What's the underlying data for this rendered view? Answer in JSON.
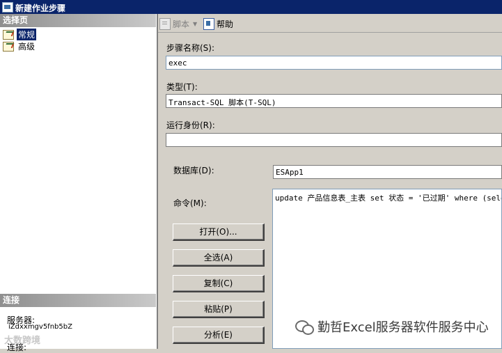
{
  "window": {
    "title": "新建作业步骤"
  },
  "left_panel": {
    "select_page_header": "选择页",
    "pages": [
      {
        "label": "常规",
        "selected": true
      },
      {
        "label": "高级",
        "selected": false
      }
    ],
    "connection_header": "连接",
    "server_label": "服务器:",
    "server_value": "iZdxxmgv5fnb5bZ",
    "connection_label": "连接:",
    "watermark": "大数跨境"
  },
  "toolbar": {
    "script_label": "脚本",
    "help_label": "帮助"
  },
  "form": {
    "step_name_label": "步骤名称(S):",
    "step_name_value": "exec",
    "type_label": "类型(T):",
    "type_value": "Transact-SQL 脚本(T-SQL)",
    "run_as_label": "运行身份(R):",
    "run_as_value": "",
    "database_label": "数据库(D):",
    "database_value": "ESApp1",
    "command_label": "命令(M):",
    "command_value": "update 产品信息表_主表 set 状态 = '已过期' where  (sele"
  },
  "buttons": {
    "open": "打开(O)...",
    "select_all": "全选(A)",
    "copy": "复制(C)",
    "paste": "粘贴(P)",
    "parse": "分析(E)"
  },
  "watermark": {
    "text": "勤哲Excel服务器软件服务中心"
  }
}
